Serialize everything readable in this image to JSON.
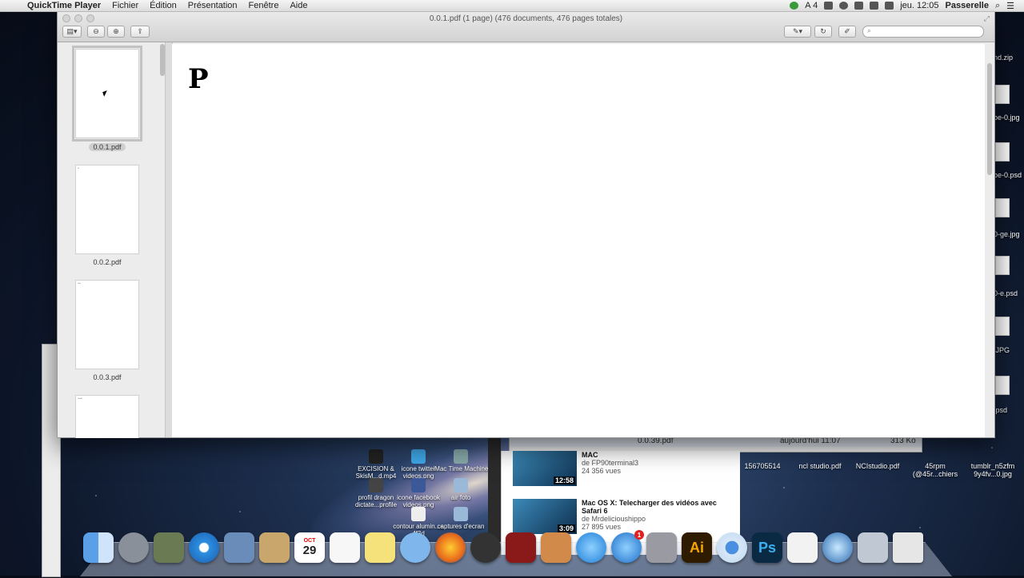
{
  "menubar": {
    "app": "QuickTime Player",
    "menus": [
      "Fichier",
      "Édition",
      "Présentation",
      "Fenêtre",
      "Aide"
    ],
    "status_badge": "A 4",
    "clock": "jeu. 12:05",
    "user": "Passerelle"
  },
  "window": {
    "title": "0.0.1.pdf (1 page) (476 documents, 476 pages totales)",
    "search_placeholder": "",
    "content_letter": "P",
    "thumbnails": [
      {
        "label": "0.0.1.pdf",
        "mark": "",
        "selected": true
      },
      {
        "label": "0.0.2.pdf",
        "mark": "ᐩ",
        "selected": false
      },
      {
        "label": "0.0.3.pdf",
        "mark": "ᐩᐩ",
        "selected": false
      },
      {
        "label": "",
        "mark": "ᐩᐩᐩ",
        "selected": false
      }
    ]
  },
  "finder": {
    "file": "0.0.39.pdf",
    "date": "aujourd'hui 11:07",
    "size": "313 Ko"
  },
  "youtube": [
    {
      "title": "MAC",
      "author": "de FP90terminal3",
      "views": "24 356 vues",
      "duration": "12:58"
    },
    {
      "title": "Mac OS X: Telecharger des vidéos avec Safari 6",
      "author": "de Mrdelicioushippo",
      "views": "27 895 vues",
      "duration": "3:09"
    }
  ],
  "desktop_icons": [
    {
      "label": "EXCISION & SkisM...d.mp4"
    },
    {
      "label": "icone twitter videos.png"
    },
    {
      "label": "iMac Time Machine"
    },
    {
      "label": "profil dragon dictate...profile"
    },
    {
      "label": "icone facebook videos.png"
    },
    {
      "label": "air foto"
    },
    {
      "label": "contour alumin...e 4f3d"
    },
    {
      "label": "captures d'ecran"
    }
  ],
  "right_files": [
    {
      "label": "156705514"
    },
    {
      "label": "ncl studio.pdf"
    },
    {
      "label": "NCIstudio.pdf"
    },
    {
      "label": "45rpm (@45r...chiers"
    },
    {
      "label": "tumblr_n5zfm 9y4fv...0.jpg"
    }
  ],
  "edge_labels": [
    "nd.zip",
    "be-0.jpg",
    "be-0.psd",
    "0-ge.jpg",
    "0-e.psd",
    ".JPG",
    ".psd"
  ],
  "dock": {
    "calendar_day": "29",
    "calendar_month": "OCT",
    "appstore_badge": "1",
    "ai_label": "Ai",
    "ps_label": "Ps"
  }
}
